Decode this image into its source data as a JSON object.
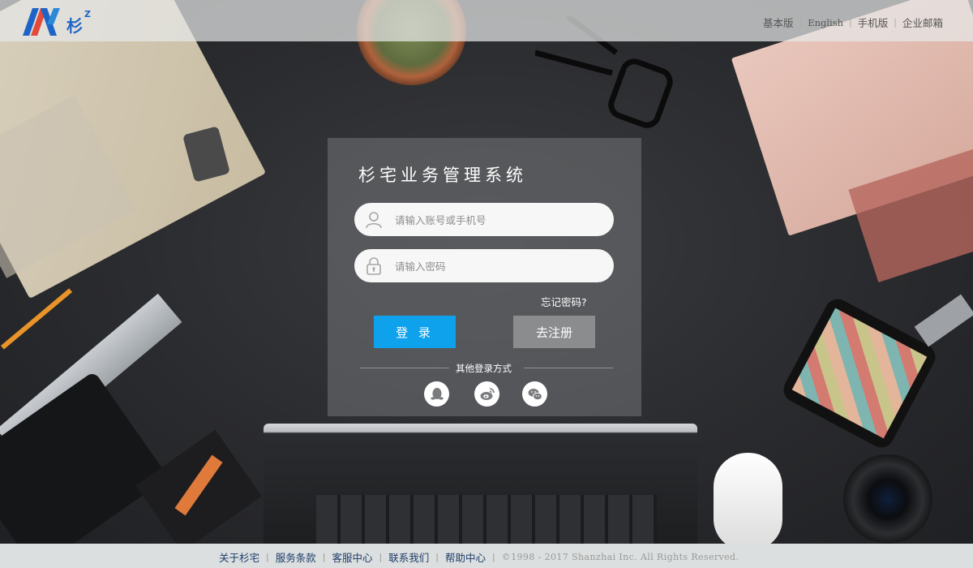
{
  "brand": {
    "name": "杉",
    "superscript": "Z"
  },
  "top_links": [
    "基本版",
    "English",
    "手机版",
    "企业邮箱"
  ],
  "login": {
    "title": "杉宅业务管理系统",
    "account_placeholder": "请输入账号或手机号",
    "password_placeholder": "请输入密码",
    "forgot_label": "忘记密码?",
    "login_label": "登 录",
    "register_label": "去注册",
    "other_methods_label": "其他登录方式",
    "social": [
      "qq-icon",
      "weibo-icon",
      "wechat-icon"
    ]
  },
  "footer": {
    "links": [
      "关于杉宅",
      "服务条款",
      "客服中心",
      "联系我们",
      "帮助中心"
    ],
    "copyright": "©1998 - 2017 Shanzhai Inc. All Rights Reserved."
  },
  "colors": {
    "accent": "#0ea1ec",
    "register": "#8b8c8e",
    "footer_link": "#1b3b6a",
    "brand": "#1e64c8"
  }
}
